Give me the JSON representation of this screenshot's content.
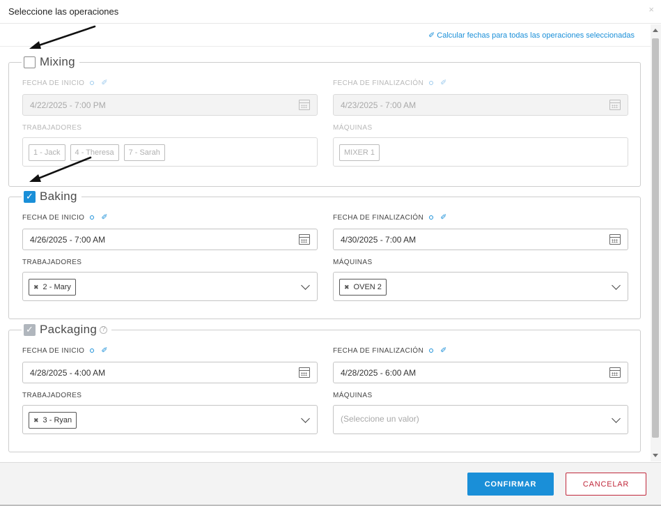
{
  "dialog": {
    "title": "Seleccione las operaciones",
    "close_icon": "×",
    "calc_link": "Calcular fechas para todas las operaciones seleccionadas"
  },
  "operations": [
    {
      "name": "Mixing",
      "checked": false,
      "enabled": false,
      "start_label": "FECHA DE INICIO",
      "start_value": "4/22/2025 - 7:00 PM",
      "end_label": "FECHA DE FINALIZACIÓN",
      "end_value": "4/23/2025 - 7:00 AM",
      "workers_label": "TRABAJADORES",
      "workers": [
        "1 - Jack",
        "4 - Theresa",
        "7 - Sarah"
      ],
      "machines_label": "MÁQUINAS",
      "machines": [
        "MIXER 1"
      ]
    },
    {
      "name": "Baking",
      "checked": true,
      "enabled": true,
      "start_label": "FECHA DE INICIO",
      "start_value": "4/26/2025 - 7:00 AM",
      "end_label": "FECHA DE FINALIZACIÓN",
      "end_value": "4/30/2025 - 7:00 AM",
      "workers_label": "TRABAJADORES",
      "workers": [
        "2 - Mary"
      ],
      "machines_label": "MÁQUINAS",
      "machines": [
        "OVEN 2"
      ]
    },
    {
      "name": "Packaging",
      "checked": true,
      "enabled": true,
      "start_label": "FECHA DE INICIO",
      "start_value": "4/28/2025 - 4:00 AM",
      "end_label": "FECHA DE FINALIZACIÓN",
      "end_value": "4/28/2025 - 6:00 AM",
      "workers_label": "TRABAJADORES",
      "workers": [
        "3 - Ryan"
      ],
      "machines_label": "MÁQUINAS",
      "machines_placeholder": "(Seleccione un valor)"
    }
  ],
  "footer": {
    "confirm_label": "CONFIRMAR",
    "cancel_label": "CANCELAR"
  },
  "colors": {
    "accent": "#1a8fd8",
    "cancel": "#c0283b",
    "annotation_arrow": "#111111"
  },
  "icons": [
    "close-icon",
    "wand-icon",
    "calendar-icon",
    "chevron-down-icon",
    "remove-tag-icon",
    "help-icon",
    "checkbox"
  ]
}
